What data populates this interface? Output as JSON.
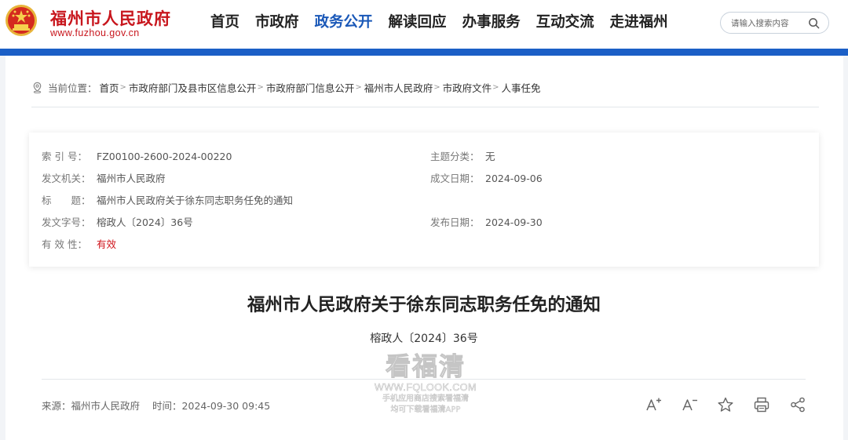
{
  "header": {
    "site_name": "福州市人民政府",
    "site_domain": "www.fuzhou.gov.cn",
    "emblem_icon": "national-emblem-icon",
    "nav": [
      {
        "label": "首页",
        "active": false
      },
      {
        "label": "市政府",
        "active": false
      },
      {
        "label": "政务公开",
        "active": true
      },
      {
        "label": "解读回应",
        "active": false
      },
      {
        "label": "办事服务",
        "active": false
      },
      {
        "label": "互动交流",
        "active": false
      },
      {
        "label": "走进福州",
        "active": false
      }
    ],
    "search": {
      "placeholder": "请输入搜索内容",
      "icon": "search-icon"
    }
  },
  "breadcrumb": {
    "icon": "location-icon",
    "label": "当前位置：",
    "items": [
      "首页",
      "市政府部门及县市区信息公开",
      "市政府部门信息公开",
      "福州市人民政府",
      "市政府文件",
      "人事任免"
    ],
    "separator": ">"
  },
  "info": {
    "index_label": "索 引 号：",
    "index_value": "FZ00100-2600-2024-00220",
    "topic_label": "主题分类：",
    "topic_value": "无",
    "issuer_label": "发文机关：",
    "issuer_value": "福州市人民政府",
    "written_date_label": "成文日期：",
    "written_date_value": "2024-09-06",
    "title_label": "标　　题：",
    "title_value": "福州市人民政府关于徐东同志职务任免的通知",
    "doc_no_label": "发文字号：",
    "doc_no_value": "榕政人〔2024〕36号",
    "publish_date_label": "发布日期：",
    "publish_date_value": "2024-09-30",
    "validity_label": "有 效 性：",
    "validity_value": "有效"
  },
  "document": {
    "title": "福州市人民政府关于徐东同志职务任免的通知",
    "number": "榕政人〔2024〕36号"
  },
  "meta": {
    "source_label": "来源：",
    "source_value": "福州市人民政府",
    "time_label": "时间：",
    "time_value": "2024-09-30 09:45"
  },
  "tools": [
    "font-increase-icon",
    "font-decrease-icon",
    "star-icon",
    "print-icon",
    "share-icon"
  ],
  "watermark": {
    "brand": "看福清",
    "url": "WWW.FQLOOK.COM",
    "line1": "手机应用商店搜索看福清",
    "line2": "均可下载看福清APP"
  },
  "colors": {
    "brand_red": "#c8161d",
    "nav_active_blue": "#1a58b8",
    "band_blue": "#1b5fc6",
    "valid_red": "#d0161d"
  }
}
